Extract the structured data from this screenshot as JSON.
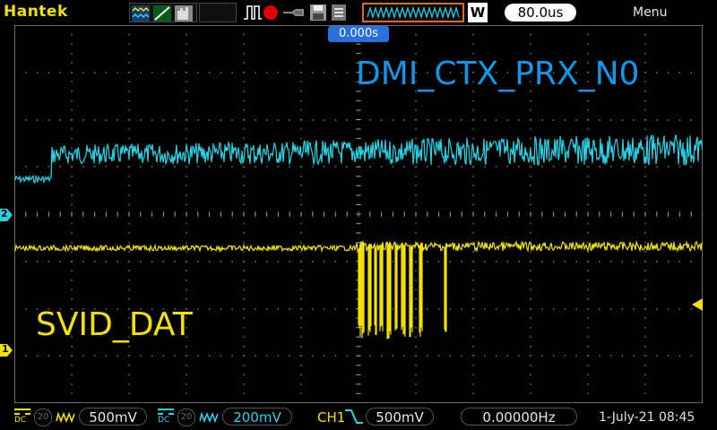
{
  "brand": "Hantek",
  "toolbar": {
    "timebase_value": "80.0us",
    "timebase_mode": "W",
    "menu_label": "Menu",
    "icons": [
      "display-mode-icon",
      "ramp-icon",
      "hold-icon",
      "pulse-trigger-icon",
      "record-icon",
      "probe-icon",
      "save-icon",
      "print-icon",
      "waveform-icon"
    ]
  },
  "trigger_position": "0.000s",
  "channels": {
    "ch2": {
      "label": "DMI_CTX_PRX_N0",
      "marker": "2",
      "color": "#22d6e8",
      "volts_div": "200mV",
      "coupling": "DC",
      "bw_limit": "20"
    },
    "ch1": {
      "label": "SVID_DAT",
      "marker": "1",
      "color": "#f2e200",
      "volts_div": "500mV",
      "coupling": "DC",
      "bw_limit": "20"
    }
  },
  "trigger": {
    "source": "CH1",
    "edge": "falling-edge-icon",
    "level": "500mV"
  },
  "frequency": "0.00000Hz",
  "datetime": "1-July-21 08:45"
}
